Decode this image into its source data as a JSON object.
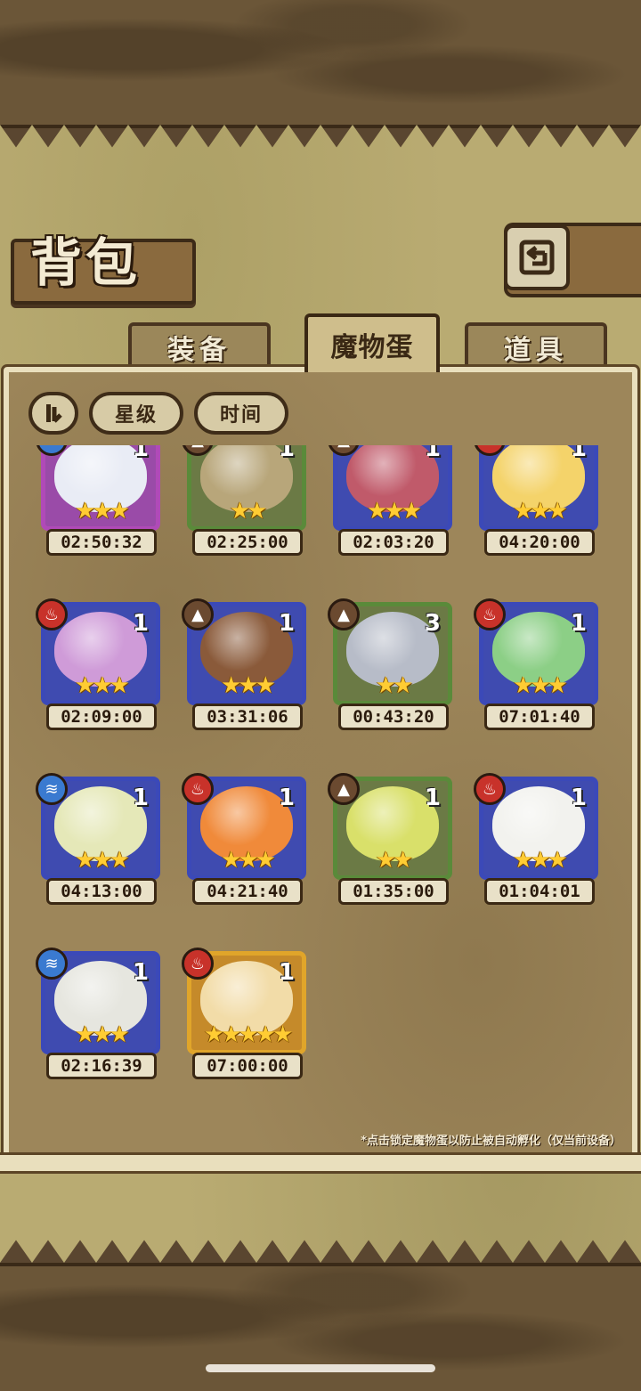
{
  "header": {
    "title": "背包"
  },
  "tabs": [
    {
      "label": "装备",
      "active": false
    },
    {
      "label": "魔物蛋",
      "active": true
    },
    {
      "label": "道具",
      "active": false
    }
  ],
  "filters": {
    "star_label": "星级",
    "time_label": "时间"
  },
  "eggs": [
    {
      "timer": "02:50:32",
      "count": "1",
      "stars": "★★★",
      "frame": "purple",
      "element": "water",
      "element_icon": "water-icon",
      "art": "#e9ecf5"
    },
    {
      "timer": "02:25:00",
      "count": "1",
      "stars": "★★",
      "frame": "green",
      "element": "earth",
      "element_icon": "earth-icon",
      "art": "#b8a67a"
    },
    {
      "timer": "02:03:20",
      "count": "1",
      "stars": "★★★",
      "frame": "blue",
      "element": "earth",
      "element_icon": "earth-icon",
      "art": "#c05a6a"
    },
    {
      "timer": "04:20:00",
      "count": "1",
      "stars": "★★★",
      "frame": "blue",
      "element": "fire",
      "element_icon": "fire-icon",
      "art": "#f4d36a"
    },
    {
      "timer": "02:09:00",
      "count": "1",
      "stars": "★★★",
      "frame": "blue",
      "element": "fire",
      "element_icon": "fire-icon",
      "art": "#cf9bd8"
    },
    {
      "timer": "03:31:06",
      "count": "1",
      "stars": "★★★",
      "frame": "blue",
      "element": "earth",
      "element_icon": "earth-icon",
      "art": "#8a5a3a"
    },
    {
      "timer": "00:43:20",
      "count": "3",
      "stars": "★★",
      "frame": "green",
      "element": "earth",
      "element_icon": "earth-icon",
      "art": "#b7bcc8"
    },
    {
      "timer": "07:01:40",
      "count": "1",
      "stars": "★★★",
      "frame": "blue",
      "element": "fire",
      "element_icon": "fire-icon",
      "art": "#8ccf86"
    },
    {
      "timer": "04:13:00",
      "count": "1",
      "stars": "★★★",
      "frame": "blue",
      "element": "water",
      "element_icon": "water-icon",
      "art": "#e5e8b8"
    },
    {
      "timer": "04:21:40",
      "count": "1",
      "stars": "★★★",
      "frame": "blue",
      "element": "fire",
      "element_icon": "fire-icon",
      "art": "#f08a3a"
    },
    {
      "timer": "01:35:00",
      "count": "1",
      "stars": "★★",
      "frame": "green",
      "element": "earth",
      "element_icon": "earth-icon",
      "art": "#d9e06a"
    },
    {
      "timer": "01:04:01",
      "count": "1",
      "stars": "★★★",
      "frame": "blue",
      "element": "fire",
      "element_icon": "fire-icon",
      "art": "#f2f2ee"
    },
    {
      "timer": "02:16:39",
      "count": "1",
      "stars": "★★★",
      "frame": "blue",
      "element": "water",
      "element_icon": "water-icon",
      "art": "#e6e6df"
    },
    {
      "timer": "07:00:00",
      "count": "1",
      "stars": "★★★★★",
      "frame": "gold",
      "element": "fire",
      "element_icon": "fire-icon",
      "art": "#f2dca8"
    }
  ],
  "hint_text": "*点击锁定魔物蛋以防止被自动孵化（仅当前设备）"
}
